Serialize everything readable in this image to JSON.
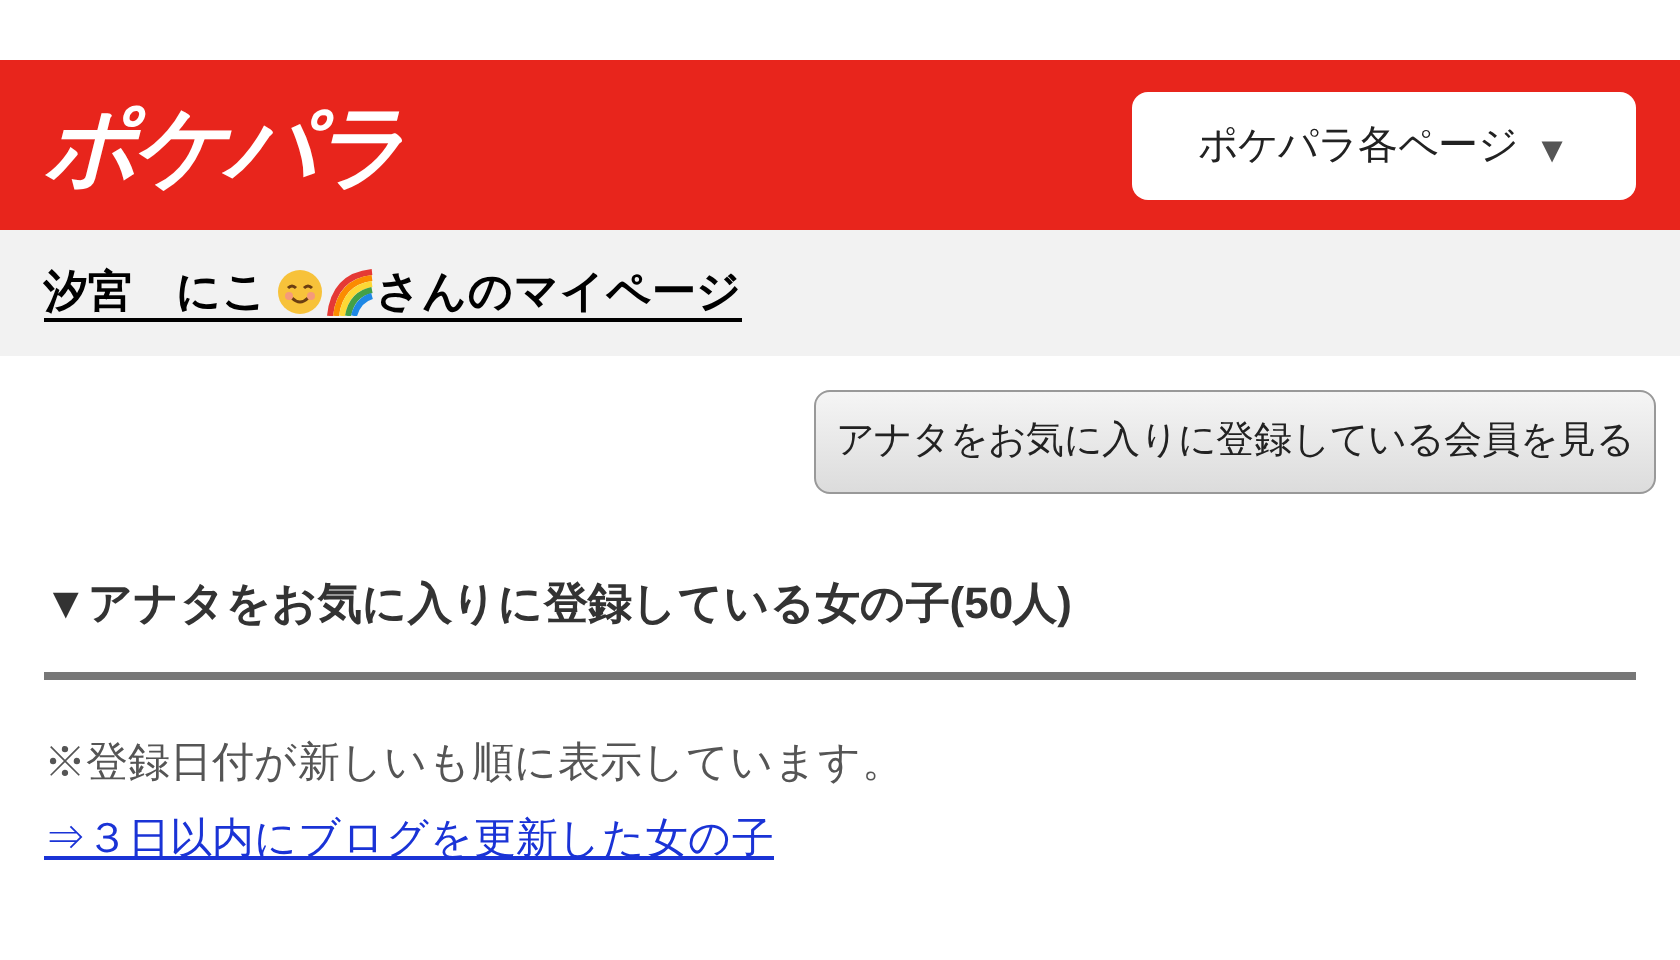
{
  "header": {
    "logo": "ポケパラ",
    "menu_button": "ポケパラ各ページ",
    "menu_caret": "▼"
  },
  "mypage_link": {
    "before": "汐宮　にこ",
    "after": "さんのマイページ"
  },
  "view_button": "アナタをお気に入りに登録している会員を見る",
  "section": {
    "heading": "▼アナタをお気に入りに登録している女の子(50人)",
    "note": "※登録日付が新しいも順に表示しています。",
    "link": "⇒３日以内にブログを更新した女の子"
  }
}
